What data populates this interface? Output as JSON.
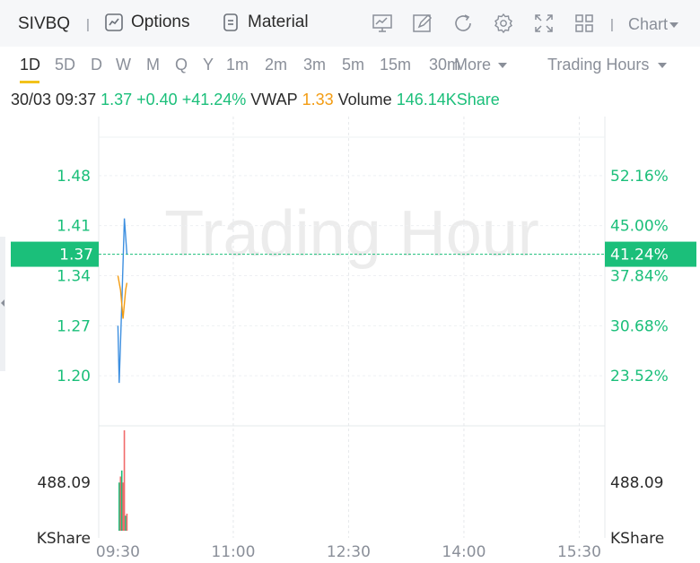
{
  "toolbar": {
    "symbol": "SIVBQ",
    "sep": "|",
    "options_label": "Options",
    "material_label": "Material",
    "chart_label": "Chart",
    "icons": [
      "indicator-icon",
      "draw-icon",
      "refresh-icon",
      "settings-icon",
      "fullscreen-icon",
      "layout-icon"
    ]
  },
  "intervals": {
    "items": [
      "1D",
      "5D",
      "D",
      "W",
      "M",
      "Q",
      "Y",
      "1m",
      "2m",
      "3m",
      "5m",
      "15m",
      "30m"
    ],
    "active": "1D",
    "more_label": "More",
    "hours_label": "Trading Hours"
  },
  "quote": {
    "datetime": "30/03 09:37",
    "price": "1.37",
    "change": "+0.40",
    "change_pct": "+41.24%",
    "vwap_label": "VWAP",
    "vwap": "1.33",
    "volume_label": "Volume",
    "volume": "146.14KShare"
  },
  "colors": {
    "up": "#1bbf7a",
    "price_line": "#3d8fe0",
    "vwap_line": "#f39c12",
    "volume_up": "#1bbf7a",
    "volume_down": "#f06a6a",
    "active_underline": "#f2c21b"
  },
  "chart_data": {
    "type": "line",
    "watermark": "Trading Hour",
    "x_ticks": [
      "09:30",
      "11:00",
      "12:30",
      "14:00",
      "15:30"
    ],
    "x_tick_minutes": [
      0,
      90,
      180,
      270,
      360
    ],
    "x_range_minutes": [
      -15,
      380
    ],
    "y_ticks_price": [
      "1.48",
      "1.41",
      "1.34",
      "1.27",
      "1.20"
    ],
    "y_ticks_pct": [
      "52.16%",
      "45.00%",
      "37.84%",
      "30.68%",
      "23.52%"
    ],
    "y_range": [
      1.13,
      1.55
    ],
    "current_price": "1.37",
    "current_pct": "41.24%",
    "series": [
      {
        "key": "price",
        "values": [
          [
            0,
            1.27
          ],
          [
            1,
            1.19
          ],
          [
            3,
            1.3
          ],
          [
            5,
            1.42
          ],
          [
            7,
            1.37
          ]
        ]
      },
      {
        "key": "vwap",
        "values": [
          [
            0,
            1.34
          ],
          [
            2,
            1.32
          ],
          [
            4,
            1.28
          ],
          [
            6,
            1.32
          ],
          [
            7,
            1.33
          ]
        ]
      }
    ],
    "volume": {
      "label_value": "488.09",
      "unit": "KShare",
      "max": 1000,
      "bars": [
        {
          "minute": 1,
          "value": 480,
          "dir": "up"
        },
        {
          "minute": 2,
          "value": 540,
          "dir": "down"
        },
        {
          "minute": 3,
          "value": 600,
          "dir": "up"
        },
        {
          "minute": 4,
          "value": 480,
          "dir": "down"
        },
        {
          "minute": 5,
          "value": 1000,
          "dir": "down"
        },
        {
          "minute": 6,
          "value": 150,
          "dir": "up"
        },
        {
          "minute": 7,
          "value": 170,
          "dir": "down"
        }
      ]
    }
  }
}
